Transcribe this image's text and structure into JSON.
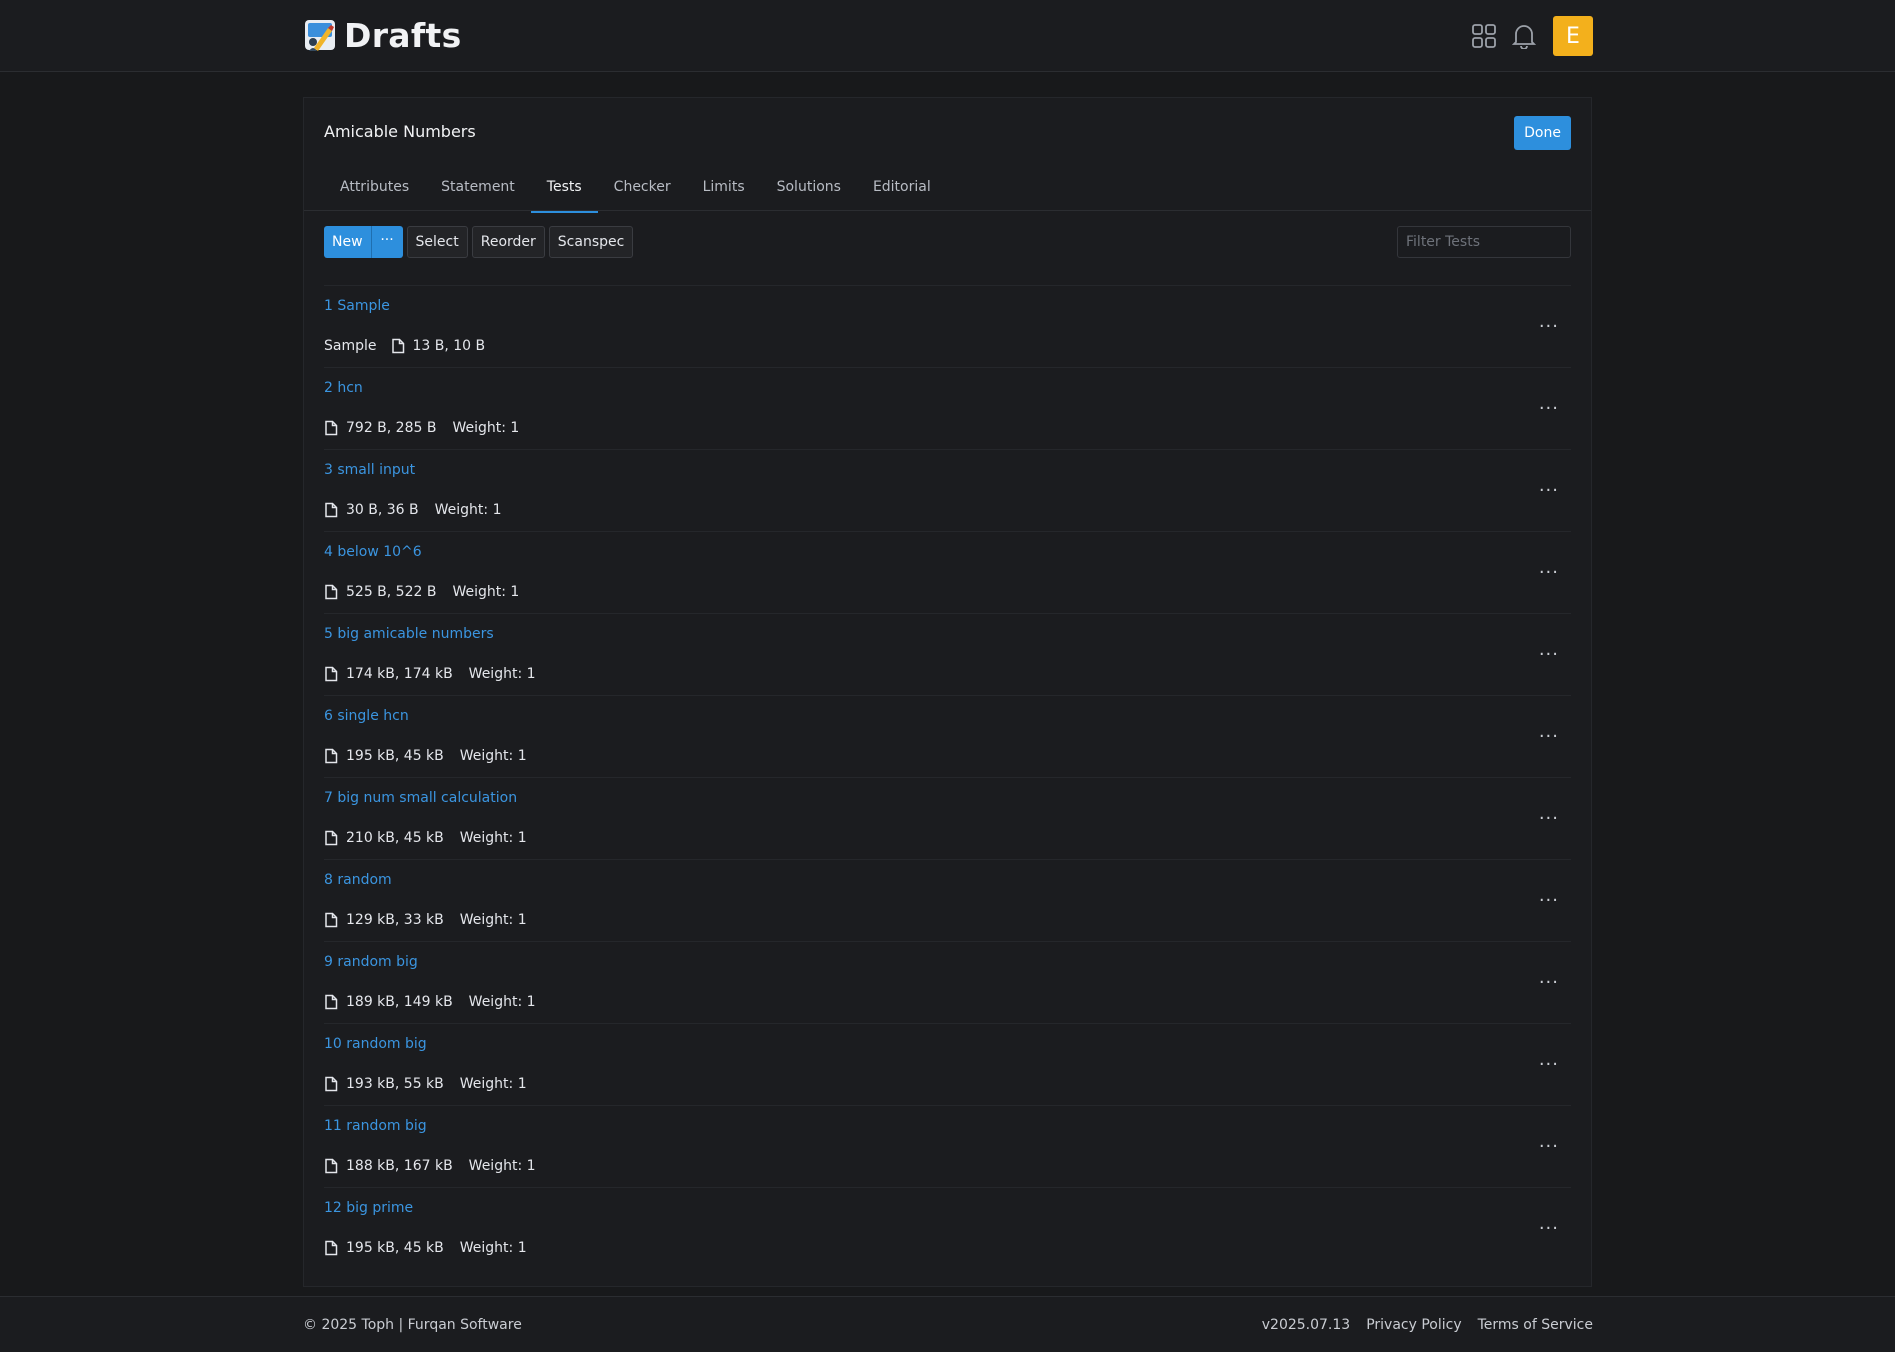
{
  "header": {
    "brand": "Drafts",
    "avatar_initial": "E",
    "avatar_color": "#f3b01c"
  },
  "problem": {
    "title": "Amicable Numbers",
    "done_label": "Done"
  },
  "tabs": [
    {
      "label": "Attributes",
      "active": false
    },
    {
      "label": "Statement",
      "active": false
    },
    {
      "label": "Tests",
      "active": true
    },
    {
      "label": "Checker",
      "active": false
    },
    {
      "label": "Limits",
      "active": false
    },
    {
      "label": "Solutions",
      "active": false
    },
    {
      "label": "Editorial",
      "active": false
    }
  ],
  "toolbar": {
    "new_label": "New",
    "more_label": "···",
    "select_label": "Select",
    "reorder_label": "Reorder",
    "scanspec_label": "Scanspec",
    "filter_placeholder": "Filter Tests"
  },
  "tests": [
    {
      "name": "1 Sample",
      "sample": "Sample",
      "sizes": "13 B, 10 B",
      "weight": ""
    },
    {
      "name": "2 hcn",
      "sample": "",
      "sizes": "792 B, 285 B",
      "weight": "Weight: 1"
    },
    {
      "name": "3 small input",
      "sample": "",
      "sizes": "30 B, 36 B",
      "weight": "Weight: 1"
    },
    {
      "name": "4 below 10^6",
      "sample": "",
      "sizes": "525 B, 522 B",
      "weight": "Weight: 1"
    },
    {
      "name": "5 big amicable numbers",
      "sample": "",
      "sizes": "174 kB, 174 kB",
      "weight": "Weight: 1"
    },
    {
      "name": "6 single hcn",
      "sample": "",
      "sizes": "195 kB, 45 kB",
      "weight": "Weight: 1"
    },
    {
      "name": "7 big num small calculation",
      "sample": "",
      "sizes": "210 kB, 45 kB",
      "weight": "Weight: 1"
    },
    {
      "name": "8 random",
      "sample": "",
      "sizes": "129 kB, 33 kB",
      "weight": "Weight: 1"
    },
    {
      "name": "9 random big",
      "sample": "",
      "sizes": "189 kB, 149 kB",
      "weight": "Weight: 1"
    },
    {
      "name": "10 random big",
      "sample": "",
      "sizes": "193 kB, 55 kB",
      "weight": "Weight: 1"
    },
    {
      "name": "11 random big",
      "sample": "",
      "sizes": "188 kB, 167 kB",
      "weight": "Weight: 1"
    },
    {
      "name": "12 big prime",
      "sample": "",
      "sizes": "195 kB, 45 kB",
      "weight": "Weight: 1"
    }
  ],
  "row_menu_label": "···",
  "footer": {
    "copyright": "© 2025 Toph | Furqan Software",
    "version": "v2025.07.13",
    "privacy": "Privacy Policy",
    "terms": "Terms of Service"
  },
  "colors": {
    "accent": "#2d8fdd",
    "link": "#3b95e0",
    "background": "#18191b"
  },
  "icons": [
    "apps-grid-icon",
    "bell-icon",
    "file-icon",
    "logo-icon"
  ]
}
